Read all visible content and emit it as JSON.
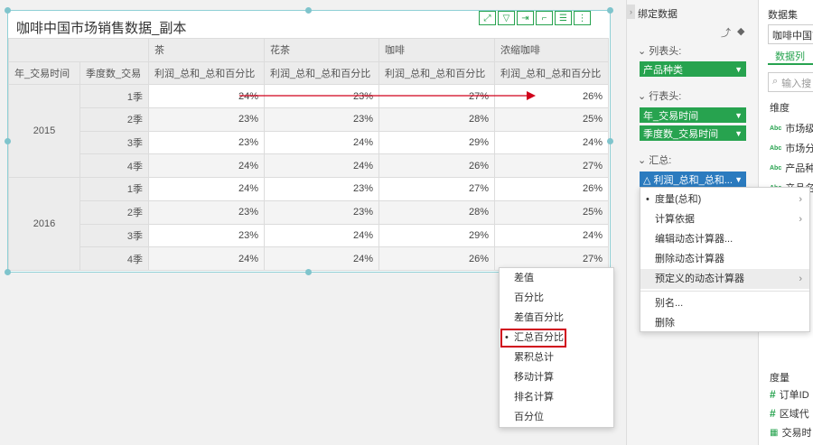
{
  "widget": {
    "title": "咖啡中国市场销售数据_副本",
    "toolbar_icons": [
      "expand-icon",
      "filter-icon",
      "export-icon",
      "chart-switch-icon",
      "list-icon",
      "more-icon"
    ]
  },
  "table": {
    "corner_headers": [
      "年_交易时间",
      "季度数_交易"
    ],
    "products": [
      "茶",
      "花茶",
      "咖啡",
      "浓缩咖啡"
    ],
    "measure_label": "利润_总和_总和百分比",
    "years": [
      {
        "year": "2015",
        "rows": [
          {
            "q": "1季",
            "vals": [
              "24%",
              "23%",
              "27%",
              "26%"
            ]
          },
          {
            "q": "2季",
            "vals": [
              "23%",
              "23%",
              "28%",
              "25%"
            ]
          },
          {
            "q": "3季",
            "vals": [
              "23%",
              "24%",
              "29%",
              "24%"
            ]
          },
          {
            "q": "4季",
            "vals": [
              "24%",
              "24%",
              "26%",
              "27%"
            ]
          }
        ]
      },
      {
        "year": "2016",
        "rows": [
          {
            "q": "1季",
            "vals": [
              "24%",
              "23%",
              "27%",
              "26%"
            ]
          },
          {
            "q": "2季",
            "vals": [
              "23%",
              "23%",
              "28%",
              "25%"
            ]
          },
          {
            "q": "3季",
            "vals": [
              "23%",
              "24%",
              "29%",
              "24%"
            ]
          },
          {
            "q": "4季",
            "vals": [
              "24%",
              "24%",
              "26%",
              "27%"
            ]
          }
        ]
      }
    ]
  },
  "bind_panel": {
    "title": "绑定数据",
    "column_header_label": "列表头:",
    "column_pills": [
      "产品种类"
    ],
    "row_header_label": "行表头:",
    "row_pills": [
      "年_交易时间",
      "季度数_交易时间"
    ],
    "summary_label": "汇总:",
    "summary_pill": "利润_总和_总和..."
  },
  "data_panel": {
    "dataset_label": "数据集",
    "dataset_value": "咖啡中国市",
    "tab_label": "数据列",
    "search_placeholder": "输入搜",
    "dimension_label": "维度",
    "dimension_fields": [
      "市场级",
      "市场分",
      "产品种",
      "产品名"
    ],
    "measure_label": "度量",
    "measure_fields": [
      "订单ID",
      "区域代",
      "交易时"
    ]
  },
  "main_menu": {
    "items": [
      "度量(总和)",
      "计算依据",
      "编辑动态计算器...",
      "删除动态计算器",
      "预定义的动态计算器",
      "别名...",
      "删除"
    ]
  },
  "sub_menu": {
    "items": [
      "差值",
      "百分比",
      "差值百分比",
      "汇总百分比",
      "累积总计",
      "移动计算",
      "排名计算",
      "百分位"
    ],
    "selected": "汇总百分比"
  },
  "colors": {
    "accent_green": "#27a34f",
    "summary_blue": "#2b7bbf",
    "highlight_red": "#d0021b",
    "selection_border": "#8fd0d6"
  }
}
